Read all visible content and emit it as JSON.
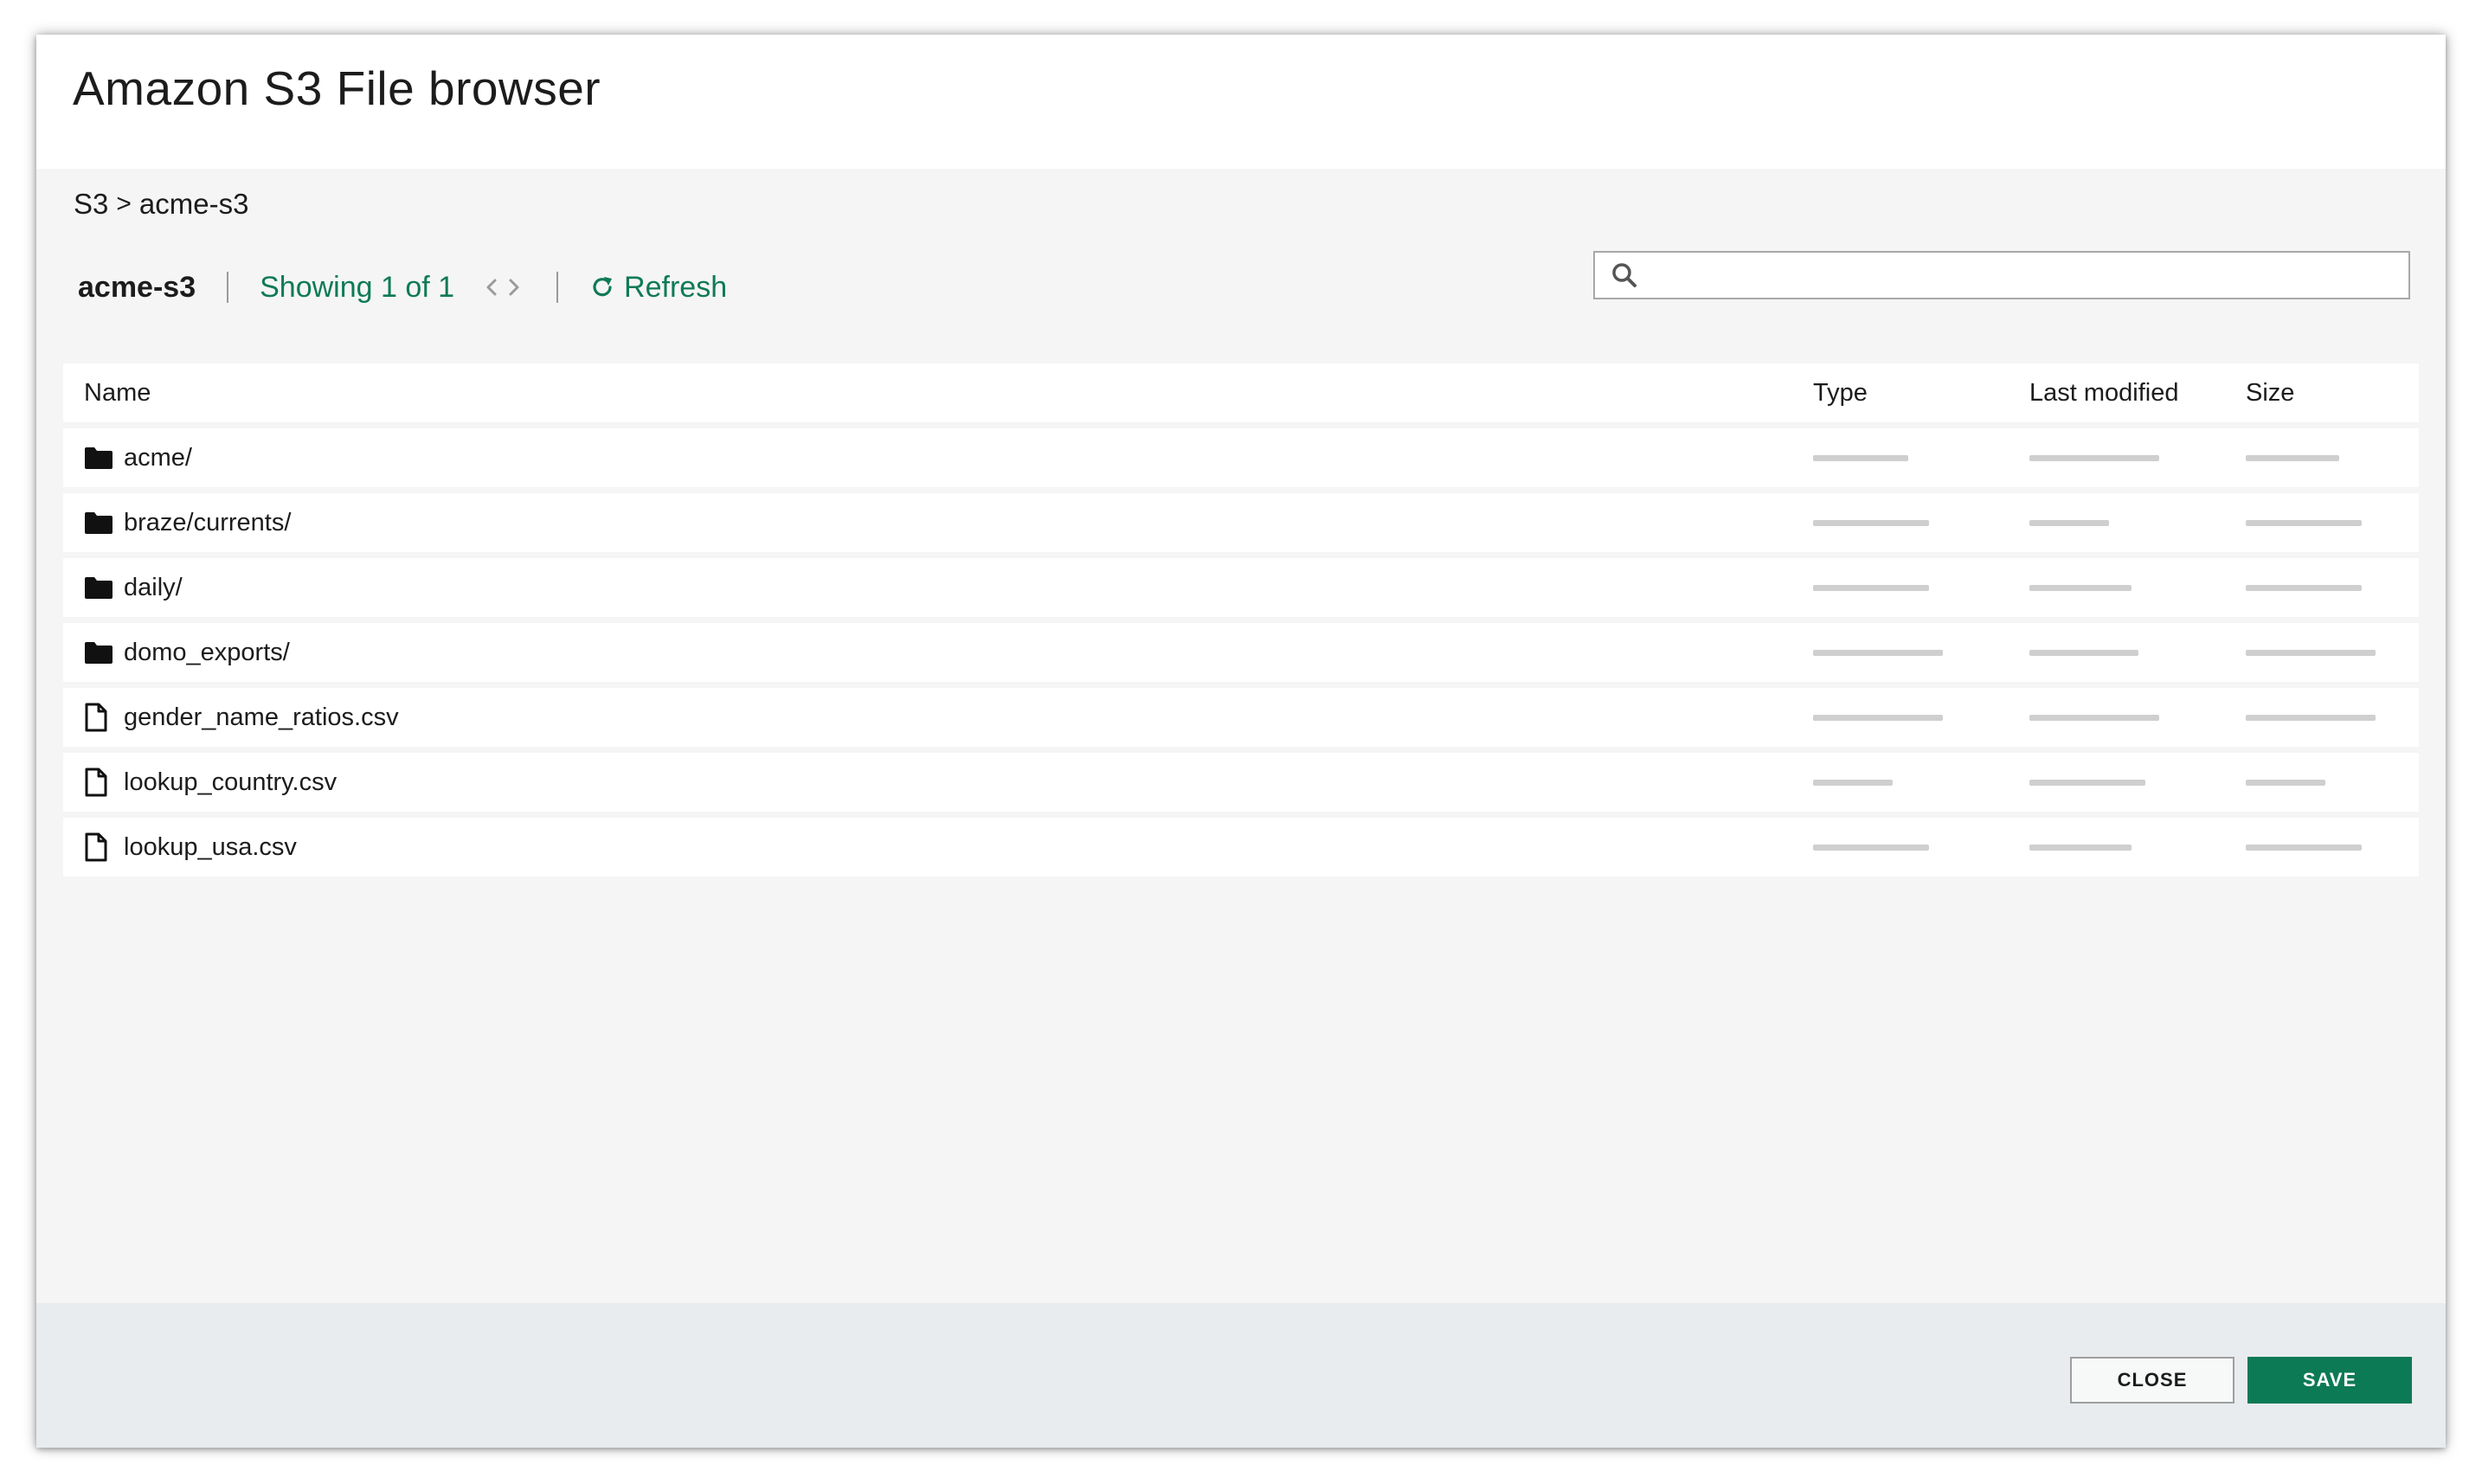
{
  "dialog": {
    "title": "Amazon S3 File browser"
  },
  "breadcrumb": {
    "root": "S3",
    "separator": ">",
    "current": "acme-s3"
  },
  "toolbar": {
    "bucket": "acme-s3",
    "showing": "Showing 1 of 1",
    "refresh_label": "Refresh",
    "prev_icon": "chevron-left-icon",
    "next_icon": "chevron-right-icon",
    "refresh_icon": "refresh-icon"
  },
  "search": {
    "placeholder": "",
    "value": "",
    "icon": "search-icon"
  },
  "table": {
    "columns": [
      "Name",
      "Type",
      "Last modified",
      "Size"
    ],
    "rows": [
      {
        "name": "acme/",
        "kind": "folder"
      },
      {
        "name": "braze/currents/",
        "kind": "folder"
      },
      {
        "name": "daily/",
        "kind": "folder"
      },
      {
        "name": "domo_exports/",
        "kind": "folder"
      },
      {
        "name": "gender_name_ratios.csv",
        "kind": "file"
      },
      {
        "name": "lookup_country.csv",
        "kind": "file"
      },
      {
        "name": "lookup_usa.csv",
        "kind": "file"
      }
    ]
  },
  "footer": {
    "close_label": "CLOSE",
    "save_label": "SAVE"
  },
  "colors": {
    "accent": "#0c7a55",
    "background": "#f4f5f4",
    "footer": "#e8ecee",
    "placeholder_bar": "#cfcfcf"
  }
}
